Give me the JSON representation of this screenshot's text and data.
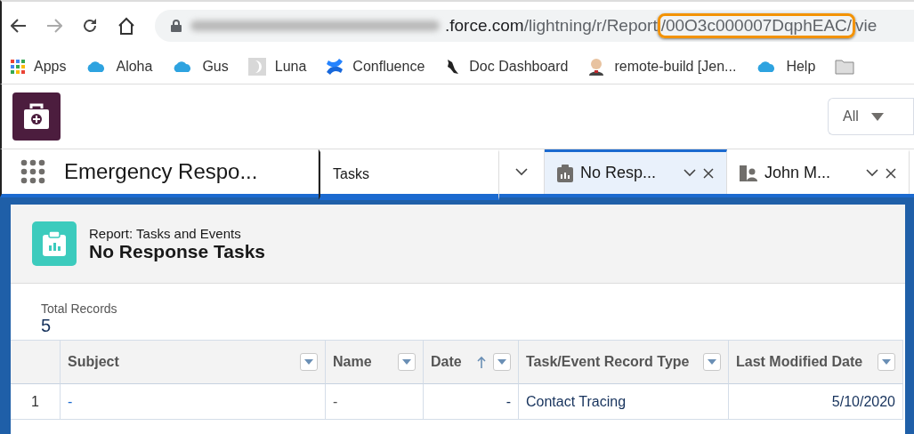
{
  "browser": {
    "url": {
      "host": ".force.com",
      "path": "/lightning/r/Report",
      "highlighted": "/00O3c000007DqphEAC/",
      "rest": "vie"
    },
    "bookmarks": [
      {
        "kind": "apps",
        "label": "Apps"
      },
      {
        "kind": "cloud",
        "label": "Aloha"
      },
      {
        "kind": "cloud",
        "label": "Gus"
      },
      {
        "kind": "moon",
        "label": "Luna"
      },
      {
        "kind": "confluence",
        "label": "Confluence"
      },
      {
        "kind": "creature",
        "label": "Doc Dashboard"
      },
      {
        "kind": "figure",
        "label": "remote-build [Jen..."
      },
      {
        "kind": "cloud",
        "label": "Help"
      },
      {
        "kind": "folder"
      }
    ]
  },
  "header": {
    "search_scope": "All"
  },
  "nav": {
    "app_name": "Emergency Respo...",
    "tabs": [
      {
        "kind": "nav",
        "label": "Tasks",
        "selected": false
      },
      {
        "kind": "report",
        "label": "No Resp...",
        "selected": true
      },
      {
        "kind": "contact",
        "label": "John M...",
        "selected": false
      }
    ]
  },
  "report": {
    "type_label": "Report: Tasks and Events",
    "title": "No Response Tasks",
    "total_label": "Total Records",
    "total": "5"
  },
  "table": {
    "columns": [
      {
        "label": "Subject",
        "kind": "link",
        "sorted": false
      },
      {
        "label": "Name",
        "kind": "text",
        "sorted": false
      },
      {
        "label": "Date",
        "kind": "date",
        "sorted": true
      },
      {
        "label": "Task/Event Record Type",
        "kind": "link",
        "sorted": false
      },
      {
        "label": "Last Modified Date",
        "kind": "date",
        "sorted": false
      }
    ],
    "rows": [
      {
        "number": "1",
        "cells": [
          "-",
          "-",
          "-",
          "Contact Tracing",
          "5/10/2020"
        ]
      }
    ]
  }
}
